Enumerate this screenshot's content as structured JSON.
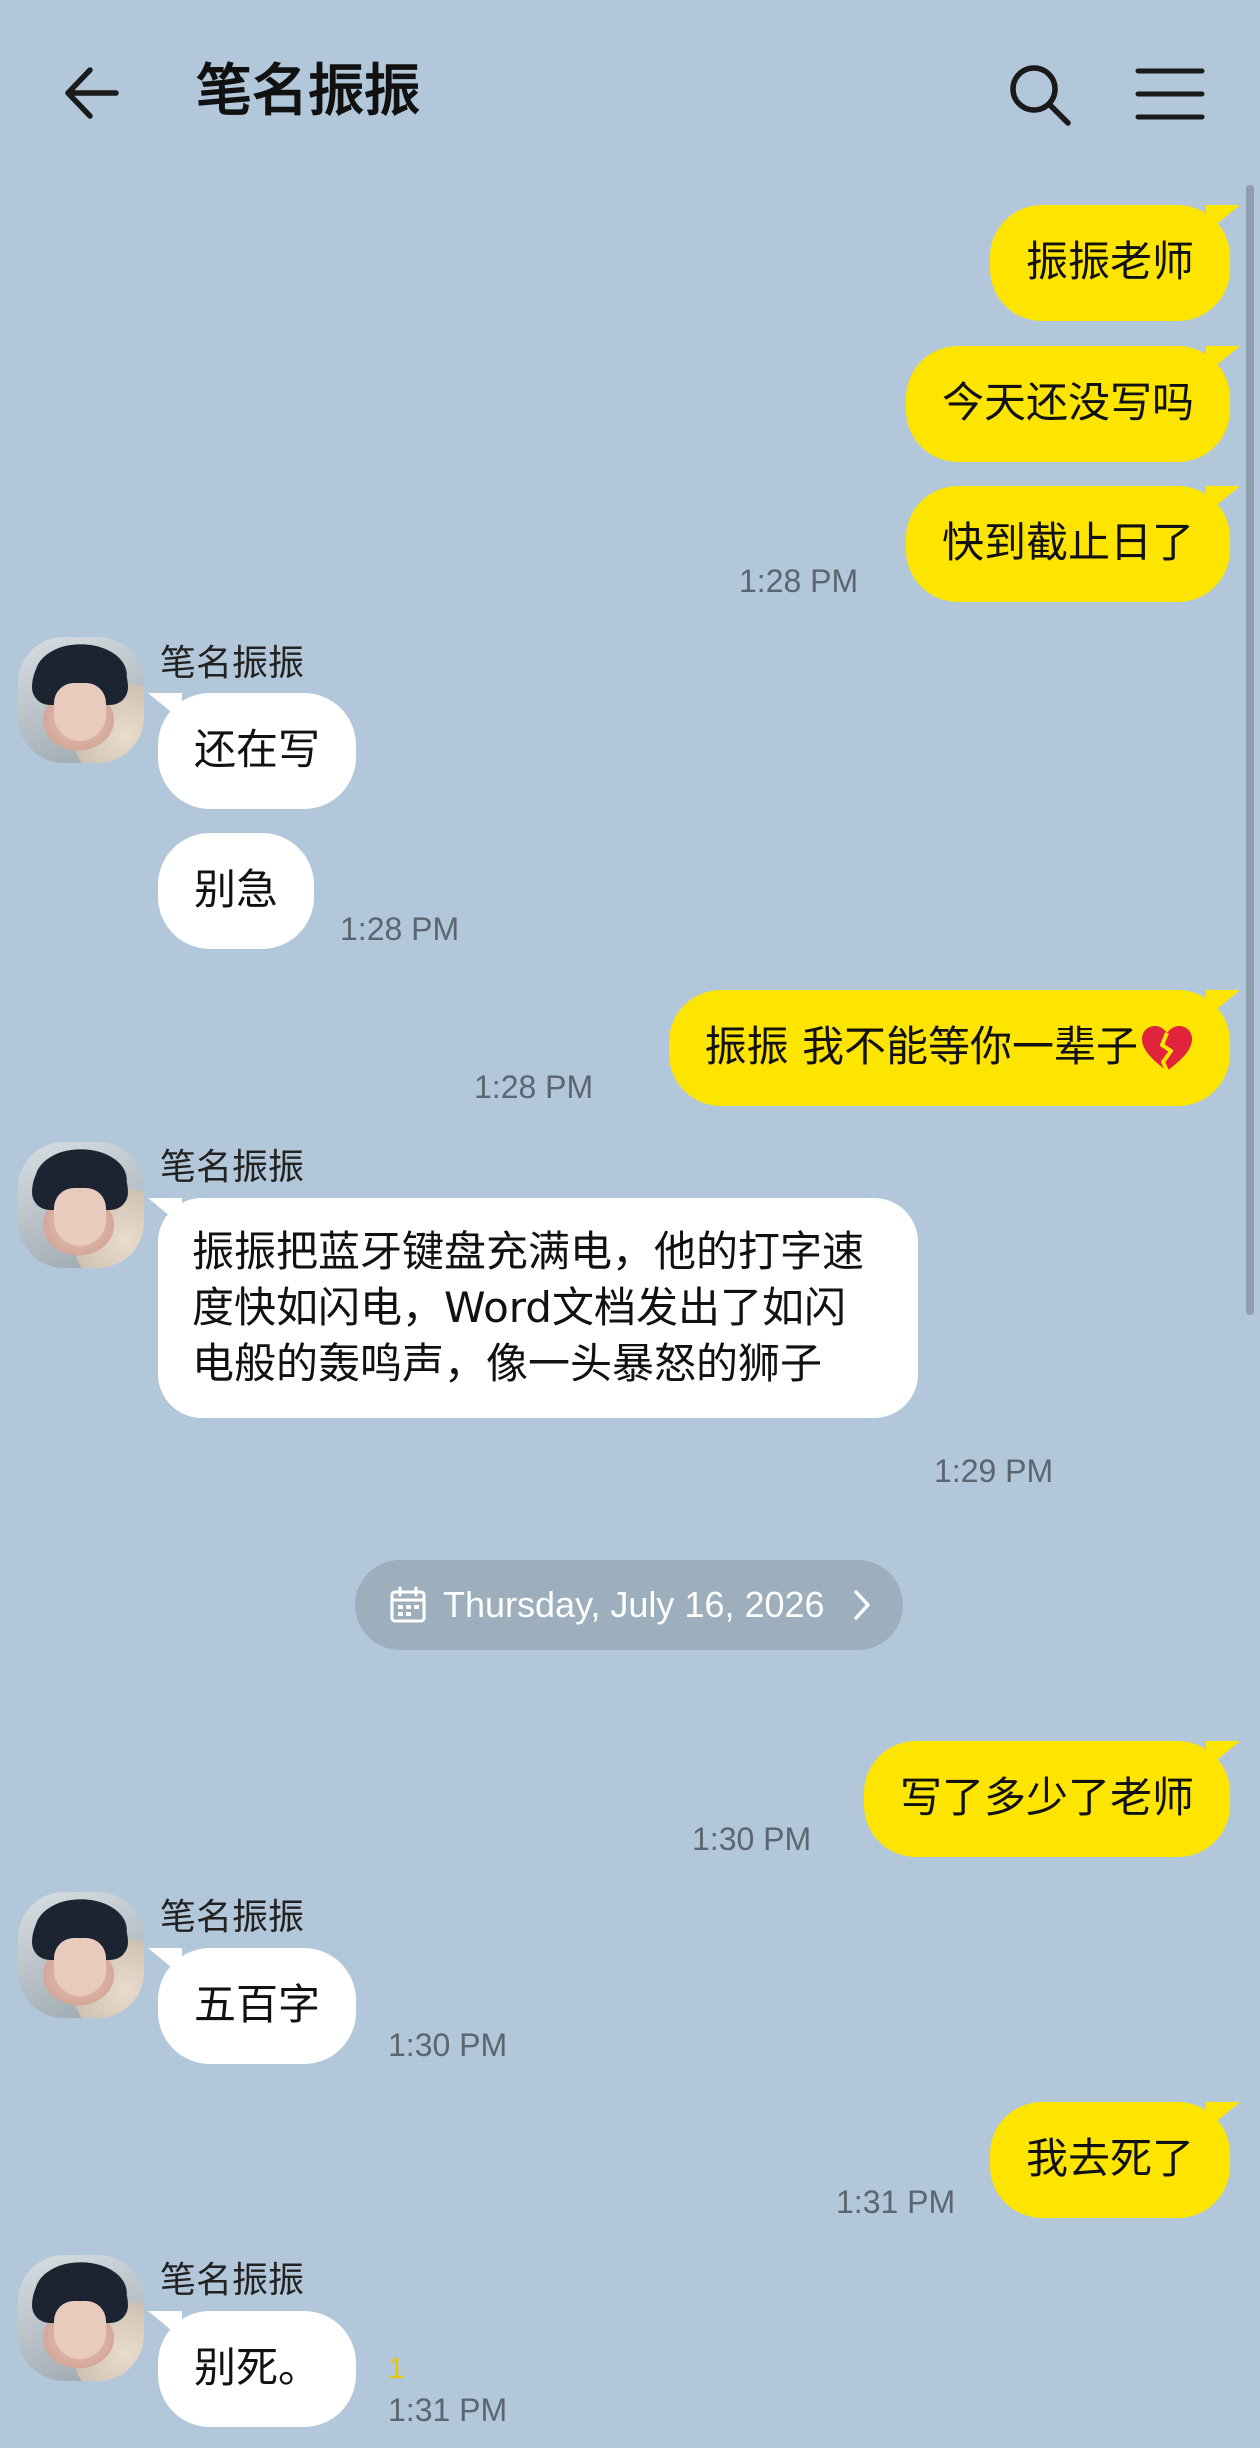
{
  "header": {
    "title": "笔名振振"
  },
  "icons": {
    "back": "arrow-left-icon",
    "search": "search-icon",
    "menu": "hamburger-menu-icon",
    "calendar": "calendar-icon",
    "chevron": "chevron-right-icon",
    "heart": "broken-heart-emoji"
  },
  "colors": {
    "background": "#b2c7da",
    "my_bubble": "#fee500",
    "their_bubble": "#ffffff",
    "date_chip": "#9daebd"
  },
  "messages": {
    "m1": {
      "text": "振振老师"
    },
    "m2": {
      "text": "今天还没写吗"
    },
    "m3": {
      "text": "快到截止日了",
      "time": "1:28 PM"
    },
    "g1": {
      "sender": "笔名振振",
      "m1": "还在写",
      "m2": "别急",
      "time": "1:28 PM"
    },
    "m4": {
      "text": "振振 我不能等你一辈子",
      "emoji": "💔",
      "time": "1:28 PM"
    },
    "g2": {
      "sender": "笔名振振",
      "text": "振振把蓝牙键盘充满电，他的打字速度快如闪电，Word文档发出了如闪电般的轰鸣声，像一头暴怒的狮子",
      "time": "1:29 PM"
    },
    "date_separator": "Thursday, July 16, 2026",
    "m5": {
      "text": "写了多少了老师",
      "time": "1:30 PM"
    },
    "g3": {
      "sender": "笔名振振",
      "text": "五百字",
      "time": "1:30 PM"
    },
    "m6": {
      "text": "我去死了",
      "time": "1:31 PM"
    },
    "g4": {
      "sender": "笔名振振",
      "text": "别死。",
      "time": "1:31 PM",
      "unread_count": "1"
    }
  }
}
